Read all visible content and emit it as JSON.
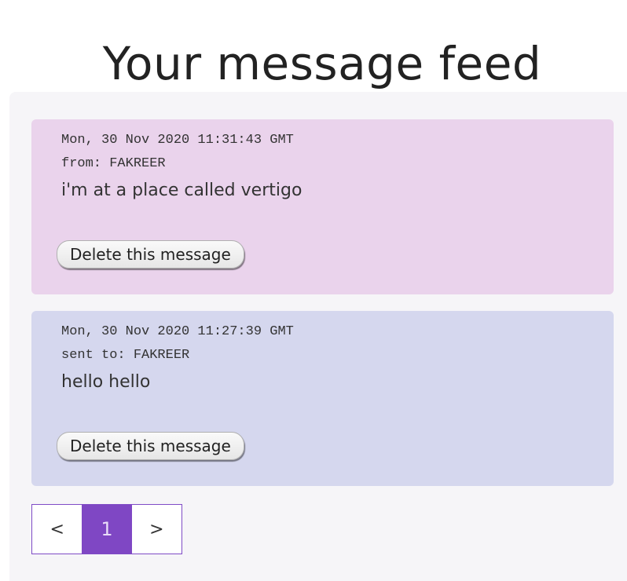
{
  "header": {
    "title": "Your message feed"
  },
  "messages": [
    {
      "timestamp": "Mon, 30 Nov 2020 11:31:43 GMT",
      "direction_line": "from: FAKREER",
      "body": "i'm at a place called vertigo",
      "delete_label": "Delete this message",
      "background": "#ead3ec"
    },
    {
      "timestamp": "Mon, 30 Nov 2020 11:27:39 GMT",
      "direction_line": "sent to: FAKREER",
      "body": "hello hello",
      "delete_label": "Delete this message",
      "background": "#d5d7ee"
    }
  ],
  "pagination": {
    "prev_label": "<",
    "current_page": "1",
    "next_label": ">",
    "accent": "#7f47c4"
  }
}
